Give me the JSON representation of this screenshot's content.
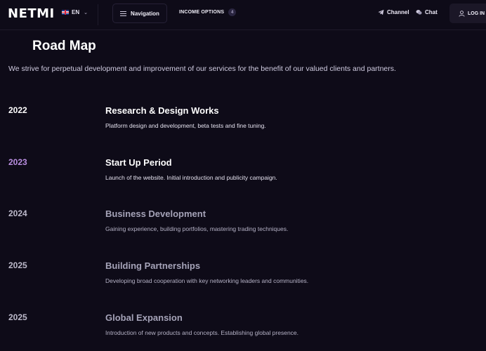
{
  "header": {
    "logo": "NETMI",
    "language": "EN",
    "navigation_label": "Navigation",
    "income_options_label": "INCOME OPTIONS",
    "income_options_count": "4",
    "channel_label": "Channel",
    "chat_label": "Chat",
    "login_label": "LOG IN"
  },
  "main": {
    "title": "Road Map",
    "subtitle": "We strive for perpetual development and improvement of our services for the benefit of our valued clients and partners.",
    "milestones": [
      {
        "year": "2022",
        "title": "Research & Design Works",
        "description": "Platform design and development, beta tests and fine tuning."
      },
      {
        "year": "2023",
        "title": "Start Up Period",
        "description": "Launch of the website. Initial introduction and publicity campaign."
      },
      {
        "year": "2024",
        "title": "Business Development",
        "description": "Gaining experience, building portfolios, mastering trading techniques."
      },
      {
        "year": "2025",
        "title": "Building Partnerships",
        "description": "Developing broad cooperation with key networking leaders and communities."
      },
      {
        "year": "2025",
        "title": "Global Expansion",
        "description": "Introduction of new products and concepts. Establishing global presence."
      }
    ]
  },
  "colors": {
    "background": "#0e0b18",
    "accent": "#b98ee0",
    "muted": "#a5a3b8"
  },
  "icons": [
    "flag-uk-icon",
    "chevron-down-icon",
    "menu-icon",
    "telegram-icon",
    "chat-icon",
    "user-icon"
  ]
}
